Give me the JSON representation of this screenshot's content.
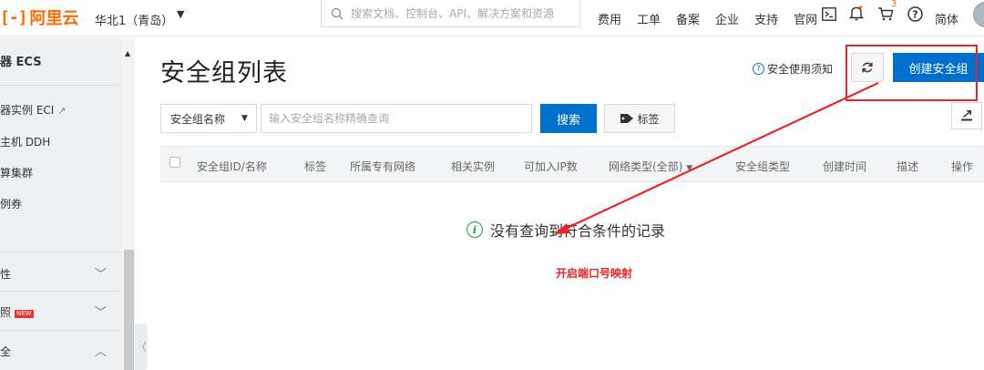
{
  "header": {
    "logo_mark": "[-]",
    "logo_text": "阿里云",
    "region": "华北1（青岛）",
    "search_placeholder": "搜索文档、控制台、API、解决方案和资源",
    "nav": [
      "费用",
      "工单",
      "备案",
      "企业",
      "支持",
      "官网"
    ],
    "cart_badge": "3",
    "language": "简体"
  },
  "sidebar": {
    "title": "器 ECS",
    "items": [
      "器实例 ECI",
      "主机 DDH",
      "算集群",
      "例券"
    ],
    "groups": [
      {
        "label": "性",
        "expanded": false
      },
      {
        "label": "照",
        "badge": "NEW",
        "expanded": false
      },
      {
        "label": "全",
        "expanded": true
      }
    ]
  },
  "main": {
    "title": "安全组列表",
    "help_link": "安全使用须知",
    "create_button": "创建安全组",
    "filter_select": "安全组名称",
    "filter_placeholder": "输入安全组名称精确查询",
    "search_button": "搜索",
    "tag_button": "标签",
    "columns": [
      "安全组ID/名称",
      "标签",
      "所属专有网络",
      "相关实例",
      "可加入IP数",
      "网络类型(全部)",
      "安全组类型",
      "创建时间",
      "描述",
      "操作"
    ],
    "empty_text": "没有查询到符合条件的记录"
  },
  "annotation": {
    "text": "开启端口号映射",
    "color": "#e8242a"
  },
  "colors": {
    "brand": "#ff6a00",
    "primary": "#0070cc",
    "success": "#1e9b3b"
  }
}
